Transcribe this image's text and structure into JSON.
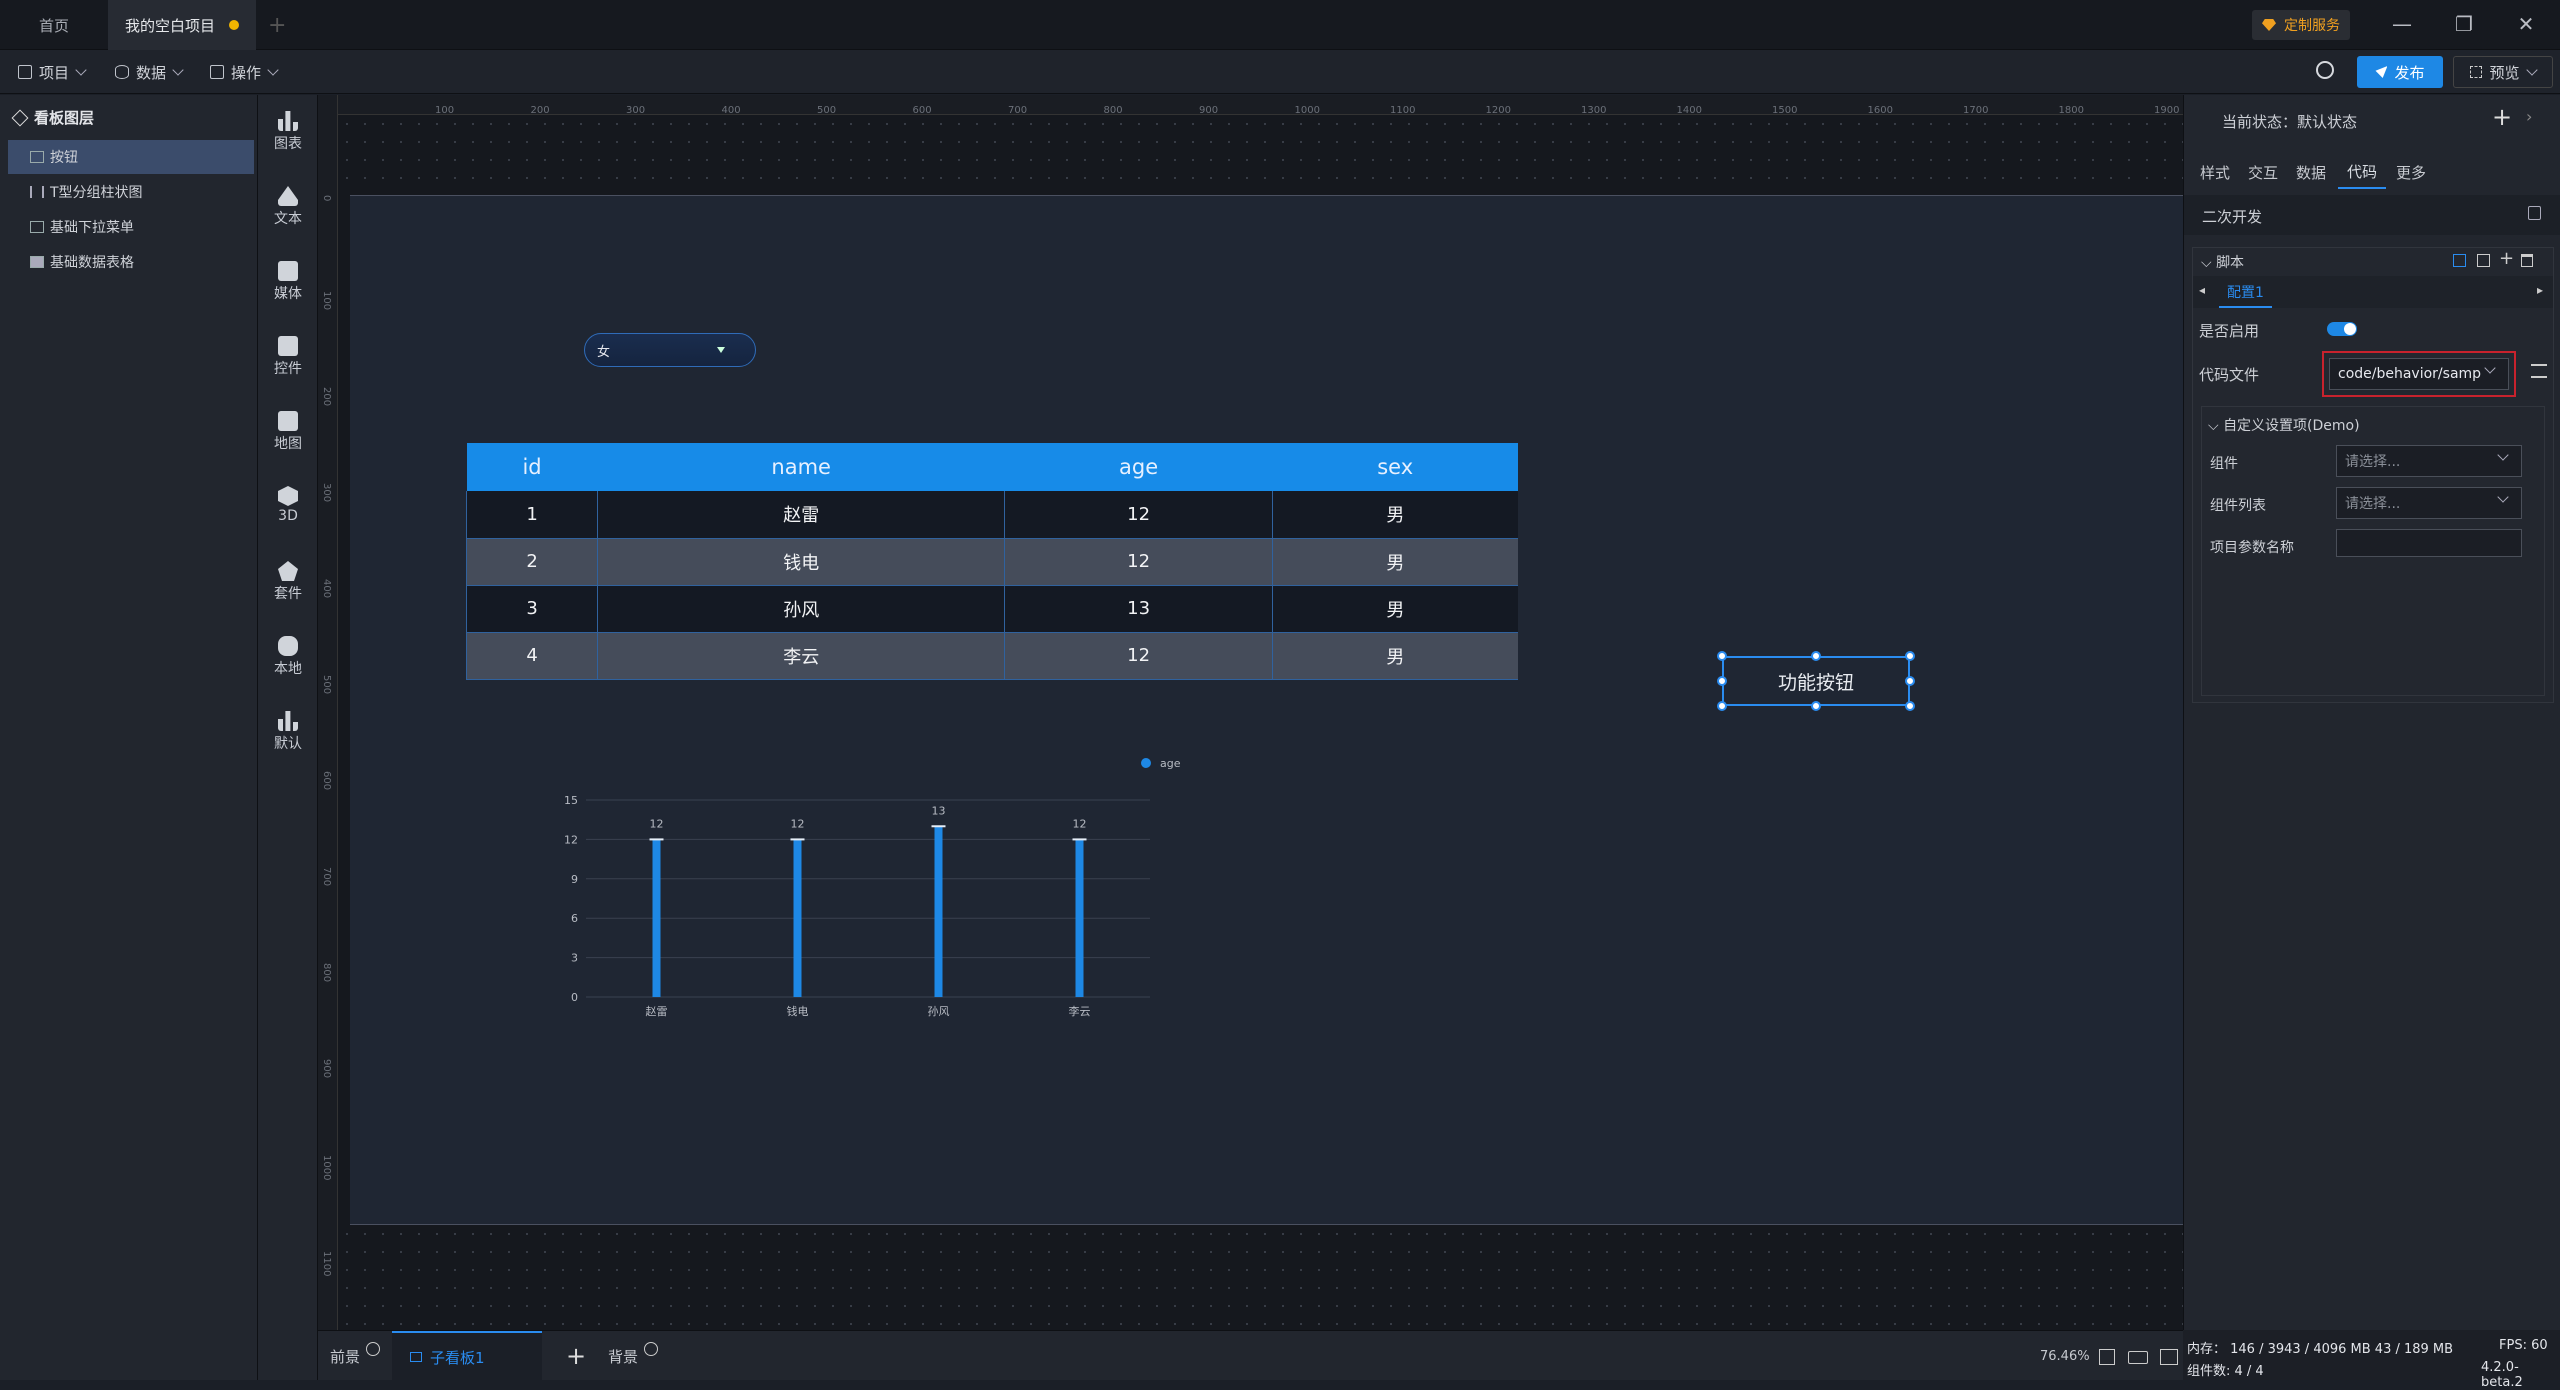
{
  "tabs": [
    {
      "label": "首页"
    },
    {
      "label": "我的空白项目"
    }
  ],
  "window": {
    "custom_service": "定制服务",
    "minimize": "—",
    "restore": "❐",
    "close": "✕"
  },
  "toolbar": {
    "project": "项目",
    "data": "数据",
    "operate": "操作",
    "publish": "发布",
    "preview": "预览"
  },
  "layers": {
    "title": "看板图层",
    "items": [
      {
        "label": "按钮"
      },
      {
        "label": "T型分组柱状图"
      },
      {
        "label": "基础下拉菜单"
      },
      {
        "label": "基础数据表格"
      }
    ]
  },
  "components": [
    {
      "label": "图表"
    },
    {
      "label": "文本"
    },
    {
      "label": "媒体"
    },
    {
      "label": "控件"
    },
    {
      "label": "地图"
    },
    {
      "label": "3D"
    },
    {
      "label": "套件"
    },
    {
      "label": "本地"
    },
    {
      "label": "默认"
    }
  ],
  "ruler": {
    "h": [
      "100",
      "200",
      "300",
      "400",
      "500",
      "600",
      "700",
      "800",
      "900",
      "1000",
      "1100",
      "1200",
      "1300",
      "1400",
      "1500",
      "1600",
      "1700",
      "1800",
      "1900"
    ],
    "v": [
      "0",
      "100",
      "200",
      "300",
      "400",
      "500",
      "600",
      "700",
      "800",
      "900",
      "1000",
      "1100"
    ]
  },
  "dropdown": {
    "value": "女"
  },
  "table": {
    "headers": [
      "id",
      "name",
      "age",
      "sex"
    ],
    "rows": [
      [
        "1",
        "赵雷",
        "12",
        "男"
      ],
      [
        "2",
        "钱电",
        "12",
        "男"
      ],
      [
        "3",
        "孙风",
        "13",
        "男"
      ],
      [
        "4",
        "李云",
        "12",
        "男"
      ]
    ]
  },
  "function_button": {
    "label": "功能按钮"
  },
  "chart_data": {
    "type": "bar",
    "categories": [
      "赵雷",
      "钱电",
      "孙风",
      "李云"
    ],
    "series": [
      {
        "name": "age",
        "values": [
          12,
          12,
          13,
          12
        ]
      }
    ],
    "yticks": [
      "0",
      "3",
      "6",
      "9",
      "12",
      "15"
    ],
    "ylim": [
      0,
      15
    ],
    "legend_position": "top-right",
    "grid": true,
    "color": "#1e88e5"
  },
  "bottom": {
    "foreground": "前景",
    "subboard": "子看板1",
    "background": "背景",
    "zoom": "76.46%"
  },
  "right_panel": {
    "state": "当前状态：默认状态",
    "tabs": [
      {
        "label": "样式"
      },
      {
        "label": "交互"
      },
      {
        "label": "数据"
      },
      {
        "label": "代码"
      },
      {
        "label": "更多"
      }
    ],
    "secondary_dev": "二次开发",
    "script": "脚本",
    "config": "配置1",
    "enabled_label": "是否启用",
    "code_file_label": "代码文件",
    "code_file_value": "code/behavior/samp",
    "custom_settings": "自定义设置项(Demo)",
    "component_label": "组件",
    "component_list_label": "组件列表",
    "param_label": "项目参数名称",
    "placeholder": "请选择..."
  },
  "status": {
    "memory": "内存： 146 / 3943 / 4096 MB  43 / 189 MB",
    "fps": "FPS:  60",
    "count": "组件数: 4 / 4",
    "version": "4.2.0-beta.2"
  }
}
